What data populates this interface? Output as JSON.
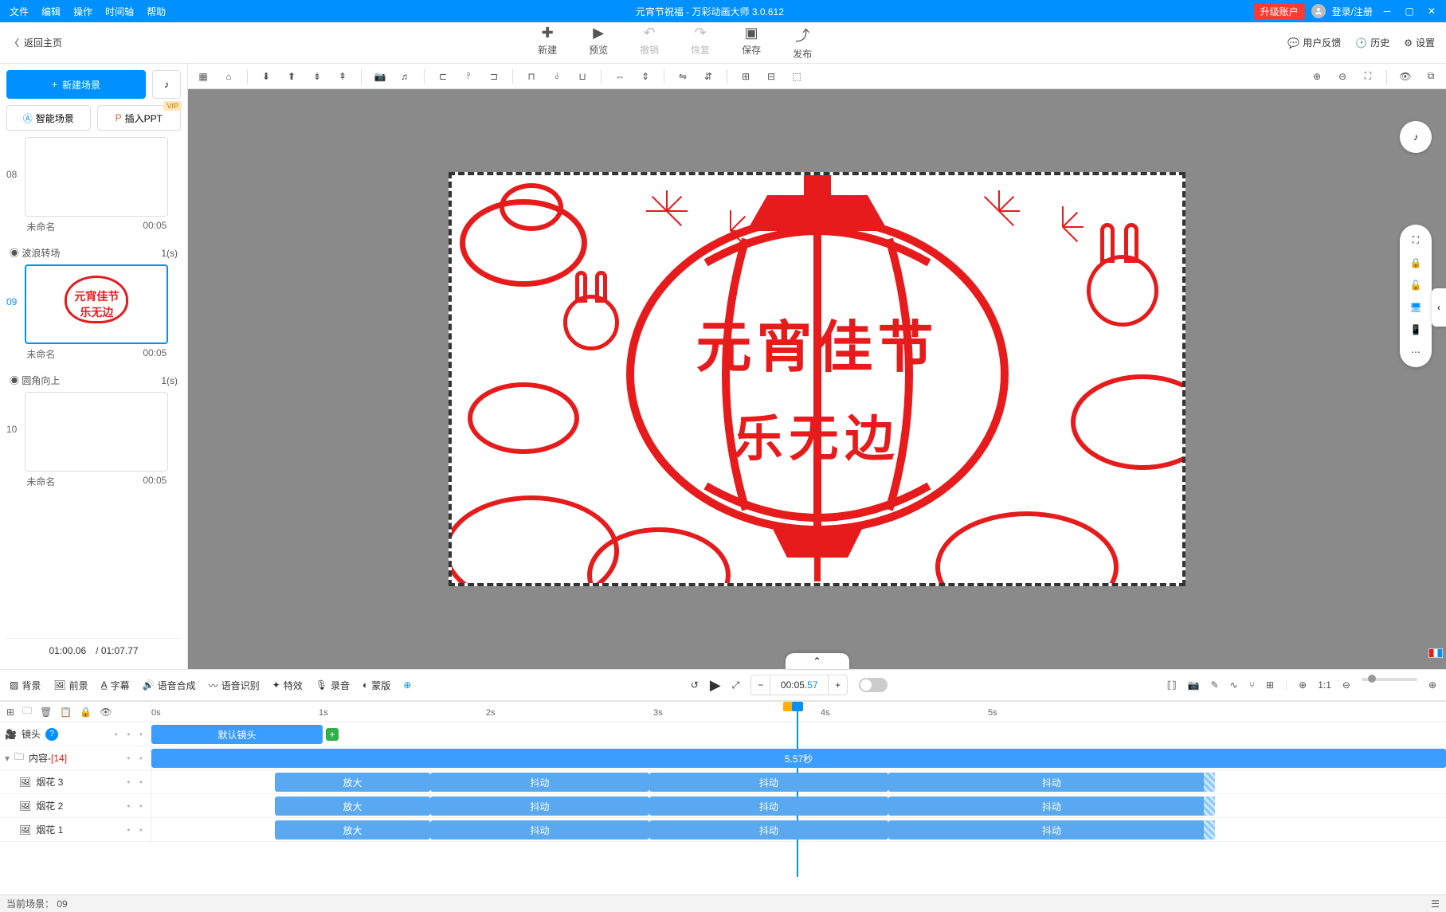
{
  "titlebar": {
    "menus": [
      "文件",
      "编辑",
      "操作",
      "时间轴",
      "帮助"
    ],
    "title": "元宵节祝福 - 万彩动画大师 3.0.612",
    "upgrade": "升级账户",
    "login": "登录/注册"
  },
  "secbar": {
    "back": "返回主页",
    "tools": {
      "new": "新建",
      "preview": "预览",
      "undo": "撤销",
      "redo": "恢复",
      "save": "保存",
      "publish": "发布"
    },
    "right": {
      "feedback": "用户反馈",
      "history": "历史",
      "settings": "设置"
    }
  },
  "sidebar": {
    "newscene": "新建场景",
    "smart": "智能场景",
    "ppt": "插入PPT",
    "vip": "VIP",
    "scenes": [
      {
        "num": "08",
        "name": "未命名",
        "dur": "00:05",
        "trans": "波浪转场",
        "trans_dur": "1(s)"
      },
      {
        "num": "09",
        "name": "未命名",
        "dur": "00:05",
        "trans": "圆角向上",
        "trans_dur": "1(s)",
        "active": true
      },
      {
        "num": "10",
        "name": "未命名",
        "dur": "00:05"
      }
    ],
    "time_current": "01:00.06",
    "time_total": "/ 01:07.77"
  },
  "canvas": {
    "line1": "元宵佳节",
    "line2": "乐无边"
  },
  "lowbar": {
    "left": [
      "背景",
      "前景",
      "字幕",
      "语音合成",
      "语音识别",
      "特效",
      "录音",
      "蒙版"
    ],
    "time": "00:05.57",
    "time_unit": ""
  },
  "timeline": {
    "ticks": [
      "0s",
      "1s",
      "2s",
      "3s",
      "4s",
      "5s"
    ],
    "camera": {
      "label": "镜头",
      "default": "默认镜头"
    },
    "content": {
      "label": "内容-",
      "count": "[14]",
      "dur": "5.57秒"
    },
    "tracks": [
      {
        "name": "烟花 3",
        "seg1": "放大",
        "shd": "抖动"
      },
      {
        "name": "烟花 2",
        "seg1": "放大",
        "shd": "抖动"
      },
      {
        "name": "烟花 1",
        "seg1": "放大",
        "shd": "抖动"
      }
    ]
  },
  "status": {
    "scene": "当前场景： 09"
  }
}
